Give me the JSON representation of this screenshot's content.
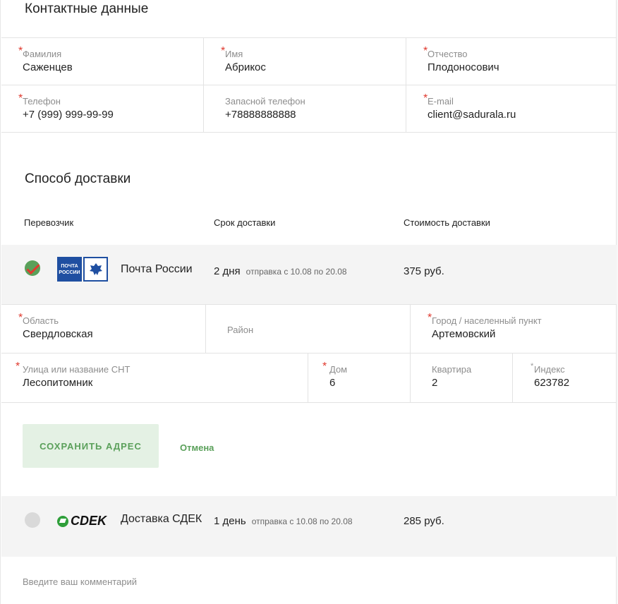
{
  "contact": {
    "title": "Контактные данные",
    "fields": {
      "last_name": {
        "label": "Фамилия",
        "value": "Саженцев",
        "required": "*"
      },
      "first_name": {
        "label": "Имя",
        "value": "Абрикос",
        "required": "*"
      },
      "patronymic": {
        "label": "Отчество",
        "value": "Плодоносович",
        "required": "*"
      },
      "phone": {
        "label": "Телефон",
        "value": "+7 (999) 999-99-99",
        "required": "*"
      },
      "alt_phone": {
        "label": "Запасной телефон",
        "value": "+78888888888"
      },
      "email": {
        "label": "E-mail",
        "value": "client@sadurala.ru",
        "required": "*"
      }
    }
  },
  "delivery": {
    "title": "Способ доставки",
    "columns": {
      "carrier": "Перевозчик",
      "term": "Срок доставки",
      "cost": "Стоимость доставки"
    },
    "options": [
      {
        "name": "Почта России",
        "logo_text": "ПОЧТА РОССИИ",
        "term": "2 дня",
        "dispatch": "отправка с 10.08 по 20.08",
        "price": "375 руб.",
        "selected": true,
        "icon": "pochta-logo-icon"
      },
      {
        "name": "Доставка СДЕК",
        "logo_text": "CDEK",
        "term": "1 день",
        "dispatch": "отправка с 10.08 по 20.08",
        "price": "285 руб.",
        "selected": false,
        "icon": "cdek-logo-icon"
      }
    ],
    "address": {
      "region": {
        "label": "Область",
        "value": "Свердловская",
        "required": "*"
      },
      "district": {
        "placeholder": "Район"
      },
      "city": {
        "label": "Город / населенный пункт",
        "value": "Артемовский",
        "required": "*"
      },
      "street": {
        "label": "Улица или название СНТ",
        "value": "Лесопитомник",
        "required": "*"
      },
      "house": {
        "label": "Дом",
        "value": "6",
        "required": "*"
      },
      "flat": {
        "label": "Квартира",
        "value": "2"
      },
      "zip": {
        "label": "Индекс",
        "value": "623782",
        "required": "*"
      }
    },
    "save_label": "СОХРАНИТЬ АДРЕС",
    "cancel_label": "Отмена"
  },
  "comment": {
    "placeholder": "Введите ваш комментарий"
  },
  "colors": {
    "accent_green": "#5aa05a",
    "required_red": "#e03a2f",
    "pochta_blue": "#1f4fa1",
    "cdek_green": "#2f9f3a"
  }
}
